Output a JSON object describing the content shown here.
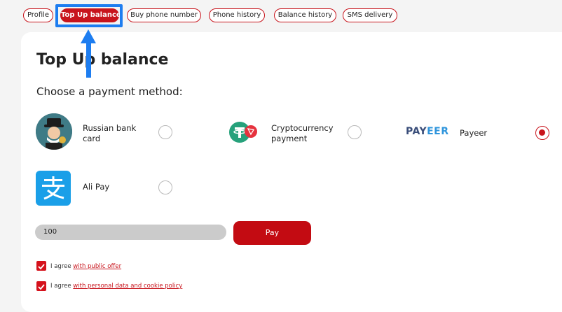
{
  "tabs": [
    {
      "label": "Profile"
    },
    {
      "label": "Top Up balance"
    },
    {
      "label": "Buy phone number"
    },
    {
      "label": "Phone history"
    },
    {
      "label": "Balance history"
    },
    {
      "label": "SMS delivery"
    }
  ],
  "active_tab": "Top Up balance",
  "page": {
    "title": "Top Up balance",
    "subtitle": "Choose a payment method:"
  },
  "payment_methods": [
    {
      "label": "Russian bank card",
      "icon": "bank-card-mascot-icon",
      "selected": false
    },
    {
      "label": "Cryptocurrency payment",
      "icon": "tether-crypto-icon",
      "selected": false
    },
    {
      "label": "Payeer",
      "icon": "payeer-logo",
      "logo_text_a": "PAY",
      "logo_text_b": "EER",
      "selected": true
    },
    {
      "label": "Ali Pay",
      "icon": "alipay-icon",
      "selected": false
    }
  ],
  "amount": {
    "value": "100"
  },
  "pay_button": {
    "label": "Pay"
  },
  "agreements": [
    {
      "prefix": "I agree ",
      "link": "with public offer",
      "checked": true
    },
    {
      "prefix": "I agree ",
      "link": "with personal data and cookie policy",
      "checked": true
    }
  ],
  "colors": {
    "accent": "#c8141c",
    "highlight": "#1d7df0",
    "page_bg": "#f4f4f4"
  }
}
